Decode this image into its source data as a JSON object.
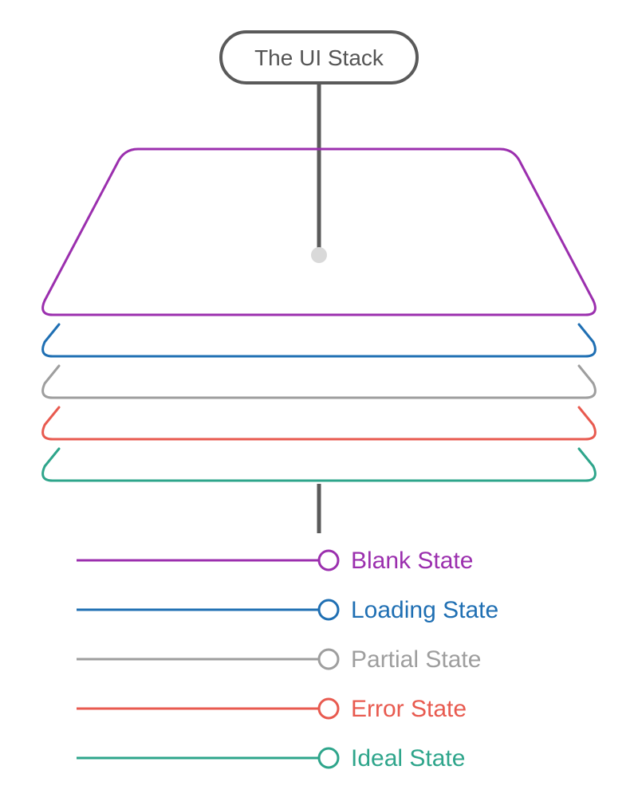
{
  "title": "The UI Stack",
  "layers": [
    {
      "id": "blank",
      "label": "Blank State",
      "color": "#9b2fae"
    },
    {
      "id": "loading",
      "label": "Loading State",
      "color": "#1f6fb3"
    },
    {
      "id": "partial",
      "label": "Partial State",
      "color": "#9e9e9e"
    },
    {
      "id": "error",
      "label": "Error State",
      "color": "#e85a4f"
    },
    {
      "id": "ideal",
      "label": "Ideal State",
      "color": "#2ea58b"
    }
  ],
  "colors": {
    "titleStroke": "#5a5a5a",
    "connector": "#5a5a5a",
    "dot": "#d9d9d9"
  }
}
